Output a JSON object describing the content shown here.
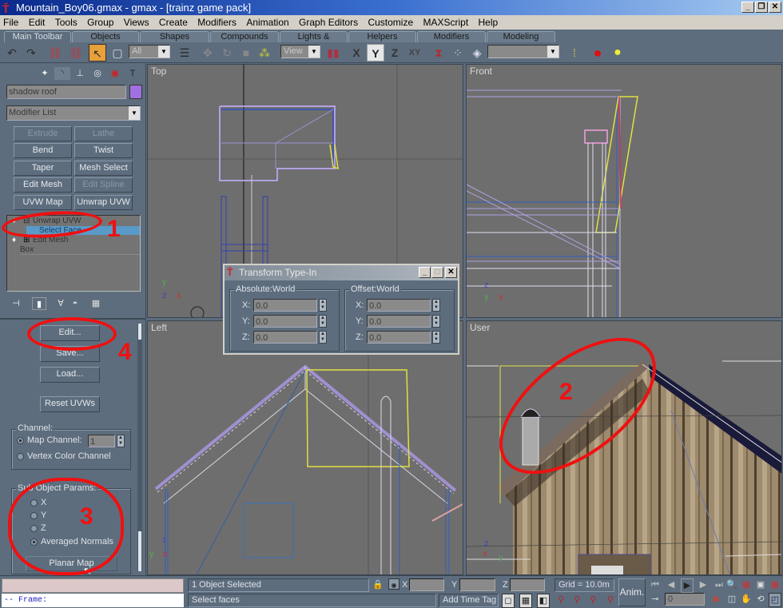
{
  "window": {
    "title": "Mountain_Boy06.gmax - gmax - [trainz game pack]",
    "controls": {
      "minimize": "_",
      "restore": "❐",
      "close": "✕"
    }
  },
  "menu": [
    "File",
    "Edit",
    "Tools",
    "Group",
    "Views",
    "Create",
    "Modifiers",
    "Animation",
    "Graph Editors",
    "Customize",
    "MAXScript",
    "Help"
  ],
  "tabs": [
    "Main Toolbar",
    "Objects",
    "Shapes",
    "Compounds",
    "Lights & Cameras",
    "Helpers",
    "Modifiers",
    "Modeling"
  ],
  "active_tab": "Main Toolbar",
  "toolbar": {
    "selection_filter": "All",
    "ref_coord": "View",
    "axis_x": "X",
    "axis_y": "Y",
    "axis_z": "Z",
    "axis_xy": "XY",
    "named_selection": ""
  },
  "command_panel": {
    "tab_icons": [
      "create-icon",
      "modify-icon",
      "hierarchy-icon",
      "motion-icon",
      "display-icon",
      "utilities-icon"
    ],
    "object_name": "shadow roof",
    "object_color": "#a070e0",
    "modifier_list": "Modifier List",
    "modifier_buttons": [
      {
        "label": "Extrude",
        "enabled": false
      },
      {
        "label": "Lathe",
        "enabled": false
      },
      {
        "label": "Bend",
        "enabled": true
      },
      {
        "label": "Twist",
        "enabled": true
      },
      {
        "label": "Taper",
        "enabled": true
      },
      {
        "label": "Mesh Select",
        "enabled": true
      },
      {
        "label": "Edit Mesh",
        "enabled": true
      },
      {
        "label": "Edit Spline",
        "enabled": false
      },
      {
        "label": "UVW Map",
        "enabled": true
      },
      {
        "label": "Unwrap UVW",
        "enabled": true
      }
    ],
    "stack": [
      {
        "label": "Unwrap UVW",
        "expand": "⊟",
        "level": 0
      },
      {
        "label": "Select Face",
        "expand": "",
        "level": 1,
        "selected": true
      },
      {
        "label": "Edit Mesh",
        "expand": "⊞",
        "level": 0
      },
      {
        "label": "Box",
        "expand": "",
        "level": 0
      }
    ],
    "rollout": {
      "edit": "Edit...",
      "save": "Save...",
      "load": "Load...",
      "reset": "Reset UVWs",
      "channel_group": "Channel:",
      "map_channel_label": "Map Channel:",
      "map_channel_value": "1",
      "vertex_color_label": "Vertex Color Channel",
      "channel_selected": "Map Channel",
      "sub_object_group": "Sub Object Params:",
      "axes": [
        "X",
        "Y",
        "Z",
        "Averaged Normals"
      ],
      "axis_selected": "Averaged Normals",
      "planar_map": "Planar Map"
    }
  },
  "viewports": {
    "top": "Top",
    "front": "Front",
    "left": "Left",
    "user": "User"
  },
  "annotations": [
    "1",
    "2",
    "3",
    "4"
  ],
  "annotation_color": "#f01010",
  "transform_dialog": {
    "title": "Transform Type-In",
    "absolute_group": "Absolute:World",
    "offset_group": "Offset:World",
    "absolute": {
      "x": "0.0",
      "y": "0.0",
      "z": "0.0"
    },
    "offset": {
      "x": "0.0",
      "y": "0.0",
      "z": "0.0"
    },
    "axis_labels": [
      "X:",
      "Y:",
      "Z:"
    ]
  },
  "statusbar": {
    "maxscript_listener": "",
    "maxscript_output": "-- Frame:",
    "selection_status": "1 Object Selected",
    "prompt": "Select faces",
    "x_label": "X",
    "y_label": "Y",
    "z_label": "Z",
    "x_value": "",
    "y_value": "",
    "z_value": "",
    "grid": "Grid = 10.0m",
    "add_time_tag": "Add Time Tag",
    "anim": "Anim.",
    "frame": "0"
  }
}
